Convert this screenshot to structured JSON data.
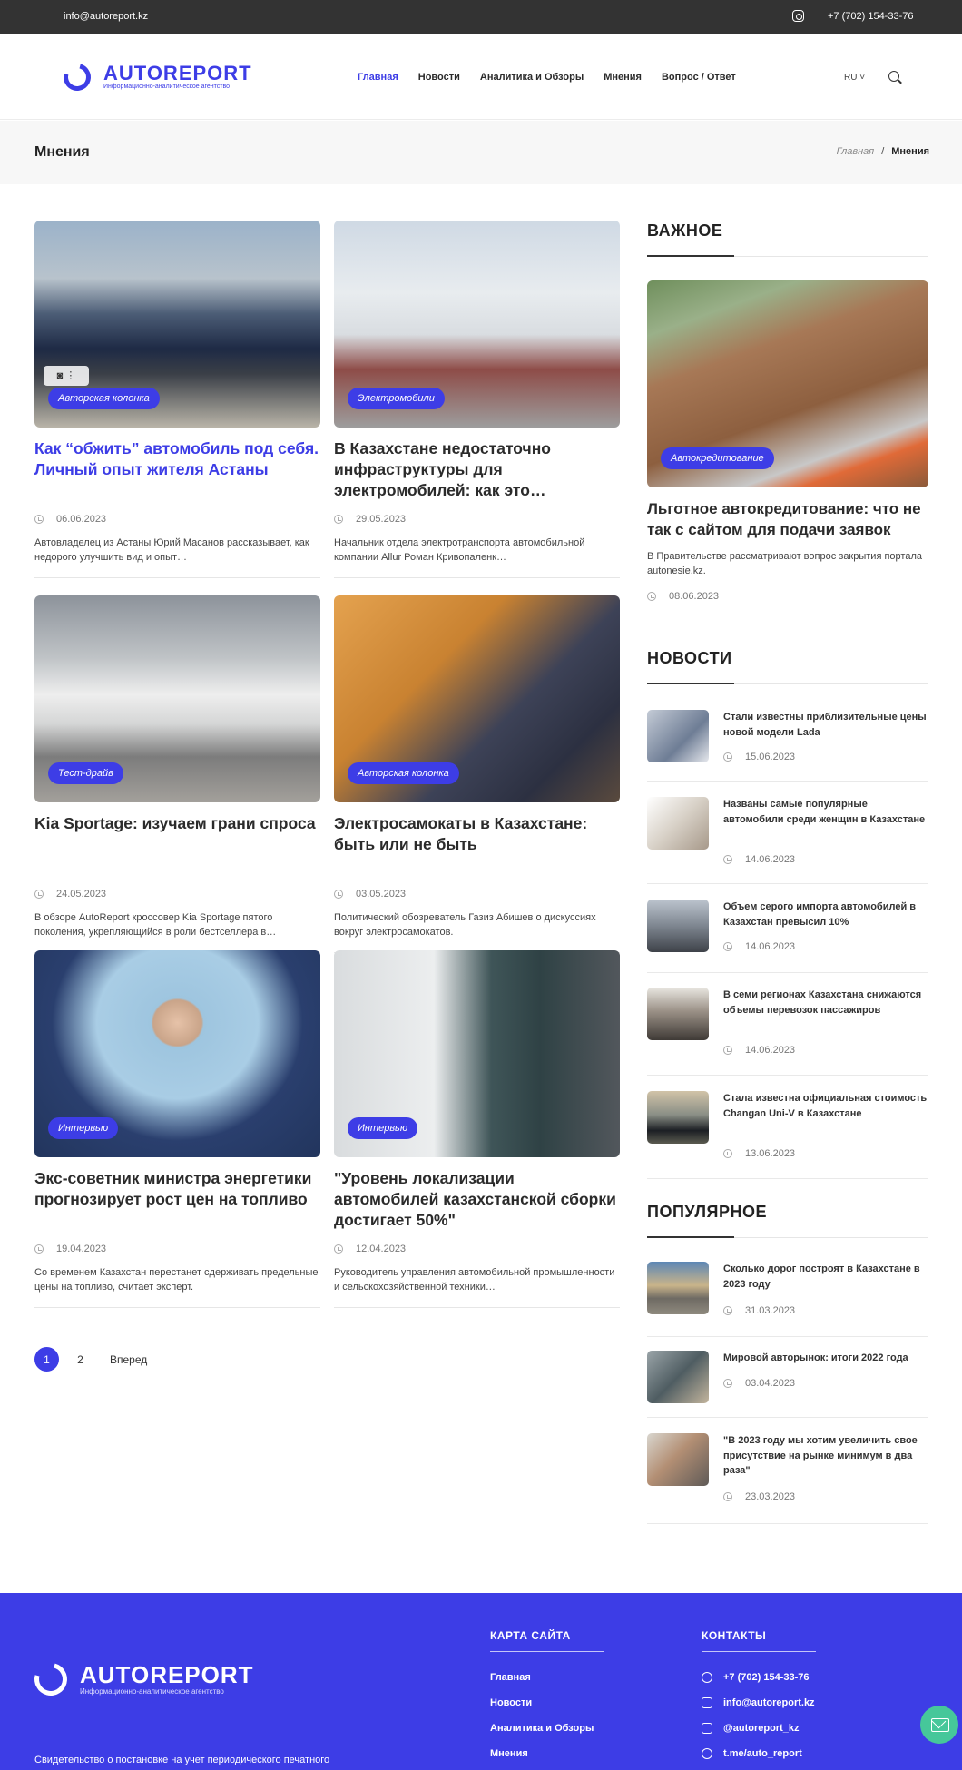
{
  "topbar": {
    "email": "info@autoreport.kz",
    "phone": "+7 (702) 154-33-76"
  },
  "header": {
    "logo": {
      "word": "AUTOREPORT",
      "subtitle": "Информационно-аналитическое агентство"
    },
    "nav": [
      "Главная",
      "Новости",
      "Аналитика и Обзоры",
      "Мнения",
      "Вопрос / Ответ"
    ],
    "lang": "RU ˅"
  },
  "titlebar": {
    "title": "Мнения",
    "crumb_home": "Главная",
    "crumb_sep": "/",
    "crumb_current": "Мнения"
  },
  "articles": [
    {
      "tag": "Авторская колонка",
      "title": "Как “обжить” автомобиль под себя. Личный опыт жителя Астаны",
      "date": "06.06.2023",
      "excerpt": "Автовладелец из Астаны Юрий Масанов рассказывает, как недорого улучшить вид и опыт…"
    },
    {
      "tag": "Электромобили",
      "title": "В Казахстане недостаточно инфраструктуры для электромобилей: как это…",
      "date": "29.05.2023",
      "excerpt": "Начальник отдела электротранспорта автомобильной компании Allur Роман Кривопаленк…"
    },
    {
      "tag": "Тест-драйв",
      "title": "Kia Sportage: изучаем грани спроса",
      "date": "24.05.2023",
      "excerpt": "В обзоре AutoReport кроссовер Kia Sportage пятого поколения, укрепляющийся в роли бестселлера в…"
    },
    {
      "tag": "Авторская колонка",
      "title": "Электросамокаты в Казахстане: быть или не быть",
      "date": "03.05.2023",
      "excerpt": "Политический обозреватель Газиз Абишев о дискуссиях вокруг электросамокатов."
    },
    {
      "tag": "Интервью",
      "title": "Экс-советник министра энергетики прогнозирует рост цен на топливо",
      "date": "19.04.2023",
      "excerpt": "Со временем Казахстан перестанет сдерживать предельные цены на топливо, считает эксперт."
    },
    {
      "tag": "Интервью",
      "title": "\"Уровень локализации автомобилей казахстанской сборки достигает 50%\"",
      "date": "12.04.2023",
      "excerpt": "Руководитель управления автомобильной промышленности и сельскохозяйственной техники…"
    }
  ],
  "pager": {
    "pages": [
      "1",
      "2"
    ],
    "next": "Вперед"
  },
  "sidebar": {
    "important": {
      "heading": "ВАЖНОЕ",
      "tag": "Автокредитование",
      "title": "Льготное автокредитование: что не так с сайтом для подачи заявок",
      "excerpt": "В Правительстве рассматривают вопрос закрытия портала autonesie.kz.",
      "date": "08.06.2023"
    },
    "news": {
      "heading": "НОВОСТИ",
      "items": [
        {
          "title": "Стали известны приблизительные цены новой модели Lada",
          "date": "15.06.2023"
        },
        {
          "title": "Названы самые популярные автомобили среди женщин в Казахстане",
          "date": "14.06.2023"
        },
        {
          "title": "Объем серого импорта автомобилей в Казахстан превысил 10%",
          "date": "14.06.2023"
        },
        {
          "title": "В семи регионах Казахстана снижаются объемы перевозок пассажиров",
          "date": "14.06.2023"
        },
        {
          "title": "Стала известна официальная стоимость Changan Uni-V в Казахстане",
          "date": "13.06.2023"
        }
      ]
    },
    "popular": {
      "heading": "ПОПУЛЯРНОЕ",
      "items": [
        {
          "title": "Сколько дорог построят в Казахстане в 2023 году",
          "date": "31.03.2023"
        },
        {
          "title": "Мировой авторынок: итоги 2022 года",
          "date": "03.04.2023"
        },
        {
          "title": "\"В 2023 году мы хотим увеличить свое присутствие на рынке минимум в два раза\"",
          "date": "23.03.2023"
        }
      ]
    }
  },
  "footer": {
    "logo": {
      "word": "AUTOREPORT",
      "subtitle": "Информационно-аналитическое агентство"
    },
    "certificate_text": "Свидетельство о постановке на учет периодического печатного",
    "sitemap": {
      "heading": "КАРТА САЙТА",
      "links": [
        "Главная",
        "Новости",
        "Аналитика и Обзоры",
        "Мнения"
      ]
    },
    "contacts": {
      "heading": "КОНТАКТЫ",
      "phone": "+7 (702) 154-33-76",
      "email": "info@autoreport.kz",
      "instagram": "@autoreport_kz",
      "telegram": "t.me/auto_report"
    }
  },
  "colors": {
    "accent": "#3d3de6",
    "topbar": "#333333",
    "fab": "#46c79a"
  }
}
